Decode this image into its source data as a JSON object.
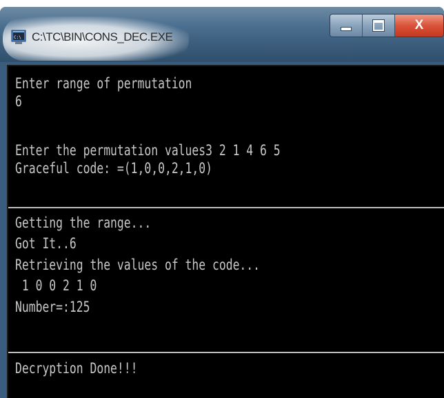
{
  "window": {
    "title": "C:\\TC\\BIN\\CONS_DEC.EXE",
    "icon": "console-app-icon",
    "controls": {
      "minimize_icon": "minimize-icon",
      "maximize_icon": "maximize-icon",
      "close_label": "X"
    },
    "colors": {
      "frame": "#3a5d7e",
      "console_background": "#000000",
      "console_text": "#c8c8c8",
      "close_button": "#d9533a"
    }
  },
  "console": {
    "section1": [
      "Enter range of permutation",
      "6",
      "",
      "Enter the permutation values3 2 1 4 6 5",
      "Graceful code: =(1,0,0,2,1,0)"
    ],
    "section2": [
      "Getting the range...",
      "Got It..6",
      "Retrieving the values of the code...",
      " 1 0 0 2 1 0",
      "Number=:125"
    ],
    "section3": [
      "Decryption Done!!!"
    ]
  }
}
